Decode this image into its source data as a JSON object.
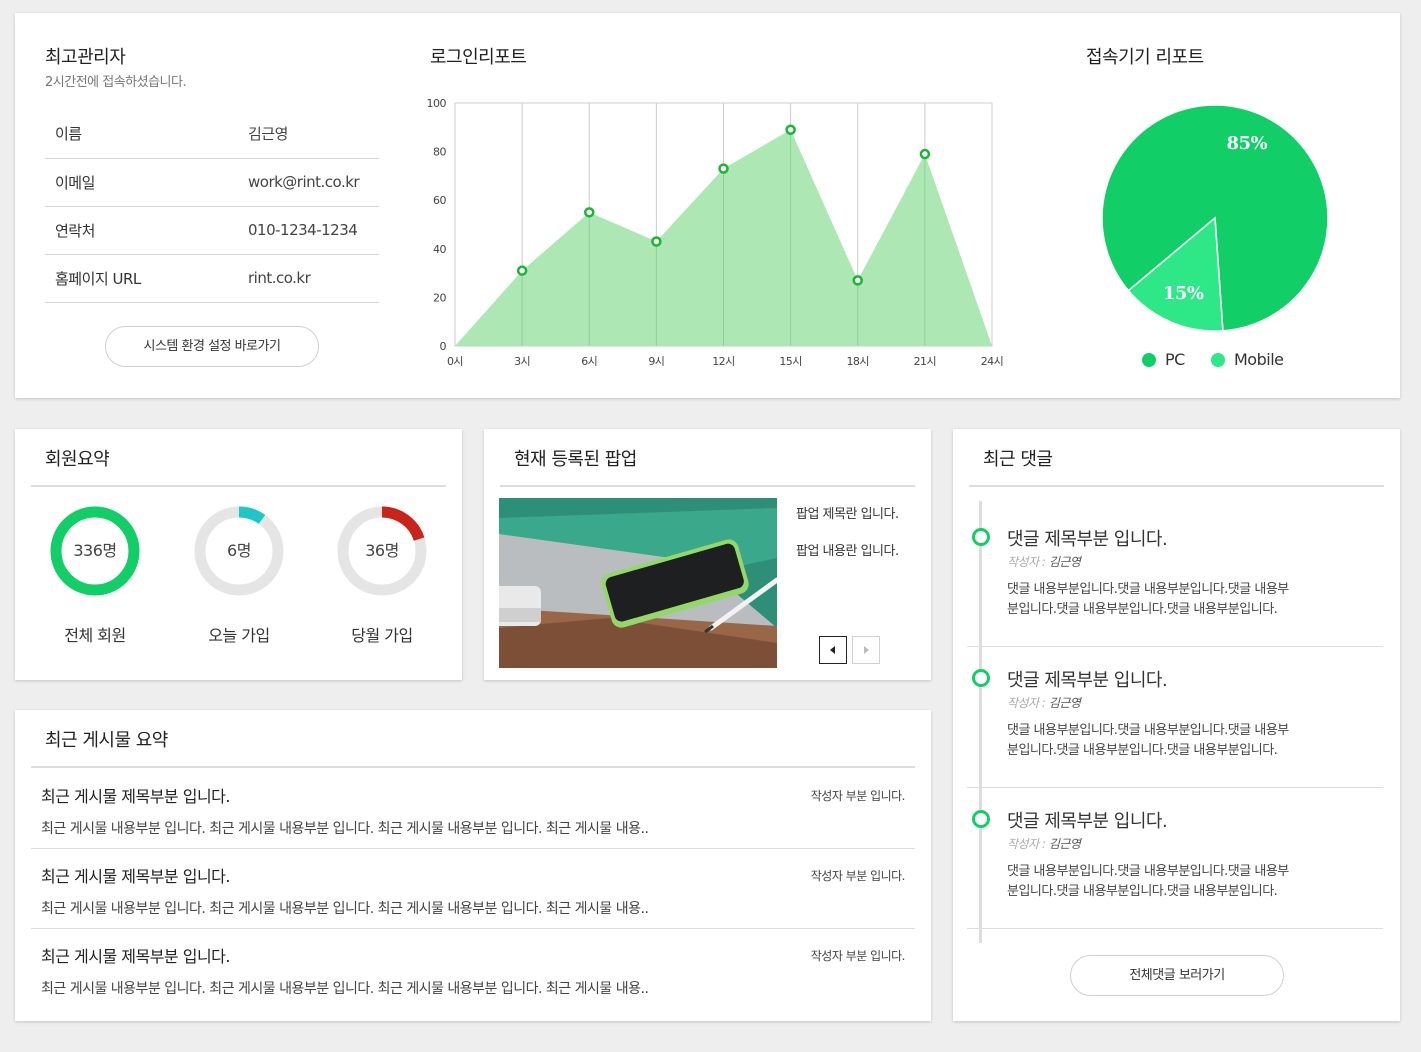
{
  "admin": {
    "title": "최고관리자",
    "subtitle": "2시간전에 접속하셨습니다.",
    "rows": [
      {
        "key": "이름",
        "value": "김근영"
      },
      {
        "key": "이메일",
        "value": "work@rint.co.kr"
      },
      {
        "key": "연락처",
        "value": "010-1234-1234"
      },
      {
        "key": "홈페이지 URL",
        "value": "rint.co.kr"
      }
    ],
    "settings_button": "시스템 환경 설정 바로가기"
  },
  "login_report": {
    "title": "로그인리포트"
  },
  "device_report": {
    "title": "접속기기 리포트",
    "legend": [
      {
        "label": "PC",
        "color": "#12ce66"
      },
      {
        "label": "Mobile",
        "color": "#2ee887"
      }
    ]
  },
  "chart_data": [
    {
      "type": "area",
      "title": "로그인리포트",
      "x": [
        "0시",
        "3시",
        "6시",
        "9시",
        "12시",
        "15시",
        "18시",
        "21시",
        "24시"
      ],
      "values": [
        0,
        31,
        55,
        43,
        73,
        89,
        27,
        79,
        0
      ],
      "markers_on": [
        "3시",
        "6시",
        "9시",
        "12시",
        "15시",
        "18시",
        "21시"
      ],
      "ylim": [
        0,
        100
      ],
      "yticks": [
        "0",
        "20",
        "40",
        "60",
        "80",
        "100"
      ],
      "grid": "vertical",
      "fill_color": "#a8e6b0",
      "marker_color": "#17b82e"
    },
    {
      "type": "pie",
      "title": "접속기기 리포트",
      "labels": [
        "PC",
        "Mobile"
      ],
      "values": [
        85,
        15
      ],
      "value_labels": [
        "85%",
        "15%"
      ],
      "colors": [
        "#12ce66",
        "#2ee887"
      ],
      "legend": "bottom"
    }
  ],
  "members": {
    "title": "회원요약",
    "stats": [
      {
        "value_text": "336명",
        "label": "전체 회원",
        "fraction": 1.0,
        "color": "#12ce66"
      },
      {
        "value_text": "6명",
        "label": "오늘 가입",
        "fraction": 0.1,
        "color": "#1fc6c6"
      },
      {
        "value_text": "36명",
        "label": "당월 가입",
        "fraction": 0.2,
        "color": "#c8241b"
      }
    ]
  },
  "popup": {
    "title": "현재 등록된 팝업",
    "subject": "팝업 제목란 입니다.",
    "content": "팝업 내용란 입니다."
  },
  "posts": {
    "title": "최근 게시물 요약",
    "items": [
      {
        "title": "최근 게시물 제목부분 입니다.",
        "author": "작성자 부분 입니다.",
        "body": "최근 게시물 내용부분 입니다. 최근 게시물 내용부분 입니다. 최근 게시물 내용부분 입니다. 최근 게시물 내용.."
      },
      {
        "title": "최근 게시물 제목부분 입니다.",
        "author": "작성자 부분 입니다.",
        "body": "최근 게시물 내용부분 입니다. 최근 게시물 내용부분 입니다. 최근 게시물 내용부분 입니다. 최근 게시물 내용.."
      },
      {
        "title": "최근 게시물 제목부분 입니다.",
        "author": "작성자 부분 입니다.",
        "body": "최근 게시물 내용부분 입니다. 최근 게시물 내용부분 입니다. 최근 게시물 내용부분 입니다. 최근 게시물 내용.."
      }
    ]
  },
  "comments": {
    "title": "최근 댓글",
    "items": [
      {
        "title": "댓글 제목부분 입니다.",
        "author_label": "작성자 :",
        "author": "김근영",
        "body": "댓글 내용부분입니다.댓글 내용부분입니다.댓글 내용부분입니다.댓글 내용부분입니다.댓글 내용부분입니다."
      },
      {
        "title": "댓글 제목부분 입니다.",
        "author_label": "작성자 :",
        "author": "김근영",
        "body": "댓글 내용부분입니다.댓글 내용부분입니다.댓글 내용부분입니다.댓글 내용부분입니다.댓글 내용부분입니다."
      },
      {
        "title": "댓글 제목부분 입니다.",
        "author_label": "작성자 :",
        "author": "김근영",
        "body": "댓글 내용부분입니다.댓글 내용부분입니다.댓글 내용부분입니다.댓글 내용부분입니다.댓글 내용부분입니다."
      }
    ],
    "all_button": "전체댓글 보러가기"
  }
}
